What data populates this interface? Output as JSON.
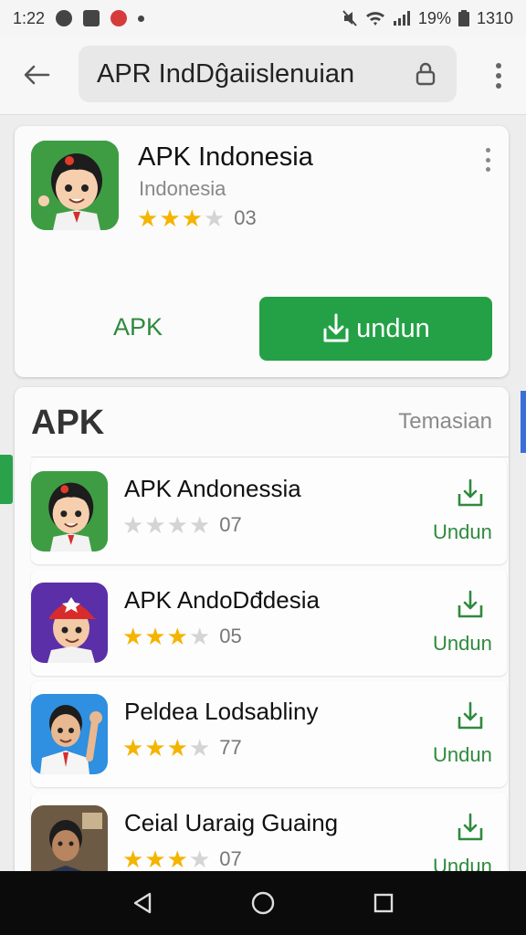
{
  "status_bar": {
    "time": "1:22",
    "battery_percent": "19%",
    "clock_right": "1310",
    "icons": [
      "cast-icon",
      "image-icon",
      "app-notification-icon",
      "mute-icon",
      "wifi-icon",
      "signal-icon",
      "battery-icon"
    ]
  },
  "toolbar": {
    "search_query": "APR IndDĝaiislenuian",
    "back_icon": "arrow-left-icon",
    "lock_icon": "lock-icon",
    "menu_icon": "more-vertical-icon"
  },
  "featured_app": {
    "title": "APK Indonesia",
    "subtitle": "Indonesia",
    "rating_stars": 3,
    "rating_text": "03",
    "secondary_label": "APK",
    "install_label": "undun",
    "install_icon": "download-icon",
    "accent": "#24a146"
  },
  "list": {
    "header": "APK",
    "see_more": "Temasian",
    "items": [
      {
        "title": "APK Andonessia",
        "stars": 0,
        "rating_text": "07",
        "action": "Undun",
        "icon": "cartoon-girl-icon"
      },
      {
        "title": "APK AndoDđdesia",
        "stars": 3,
        "rating_text": "05",
        "action": "Undun",
        "icon": "cartoon-boy-cap-icon"
      },
      {
        "title": "Peldea Lodsabliny",
        "stars": 3,
        "rating_text": "77",
        "action": "Undun",
        "icon": "cartoon-man-wave-icon"
      },
      {
        "title": "Ceial Uaraig Guaing",
        "stars": 3,
        "rating_text": "07",
        "action": "Undun",
        "icon": "photo-man-icon"
      }
    ]
  },
  "nav": {
    "back": "nav-back-icon",
    "home": "nav-home-icon",
    "recents": "nav-recents-icon"
  }
}
